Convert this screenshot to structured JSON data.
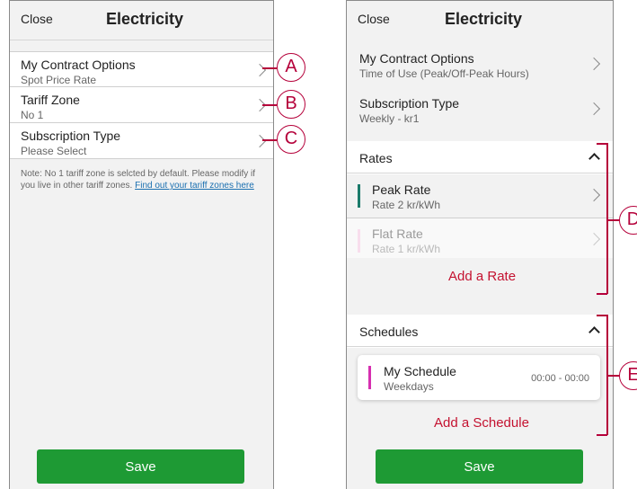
{
  "left": {
    "header": {
      "close_label": "Close",
      "title": "Electricity"
    },
    "rows": [
      {
        "label": "My Contract Options",
        "value": "Spot Price Rate",
        "callout": "A"
      },
      {
        "label": "Tariff Zone",
        "value": "No 1",
        "callout": "B"
      },
      {
        "label": "Subscription Type",
        "value": "Please Select",
        "callout": "C"
      }
    ],
    "note": {
      "text": "Note: No 1 tariff zone is selcted by default. Please modify if you live in other tariff zones. ",
      "link": "Find out your tariff zones here"
    },
    "save_label": "Save"
  },
  "right": {
    "header": {
      "close_label": "Close",
      "title": "Electricity"
    },
    "rows": [
      {
        "label": "My Contract Options",
        "value": "Time of Use (Peak/Off-Peak Hours)"
      },
      {
        "label": "Subscription Type",
        "value": "Weekly - kr1"
      }
    ],
    "rates": {
      "title": "Rates",
      "items": [
        {
          "label": "Peak Rate",
          "value": "Rate 2 kr/kWh",
          "color": "#1a7a6a"
        },
        {
          "label": "Flat Rate",
          "value": "Rate 1 kr/kWh",
          "color": "#f0b8d8"
        }
      ],
      "add_label": "Add a Rate",
      "callout": "D"
    },
    "schedules": {
      "title": "Schedules",
      "items": [
        {
          "label": "My Schedule",
          "value": "Weekdays",
          "time": "00:00 - 00:00",
          "color": "#d62fb0"
        }
      ],
      "add_label": "Add  a Schedule",
      "callout": "E"
    },
    "save_label": "Save"
  },
  "colors": {
    "accent_green": "#1e9a34",
    "callout": "#b5003a",
    "add_link": "#c41230"
  }
}
